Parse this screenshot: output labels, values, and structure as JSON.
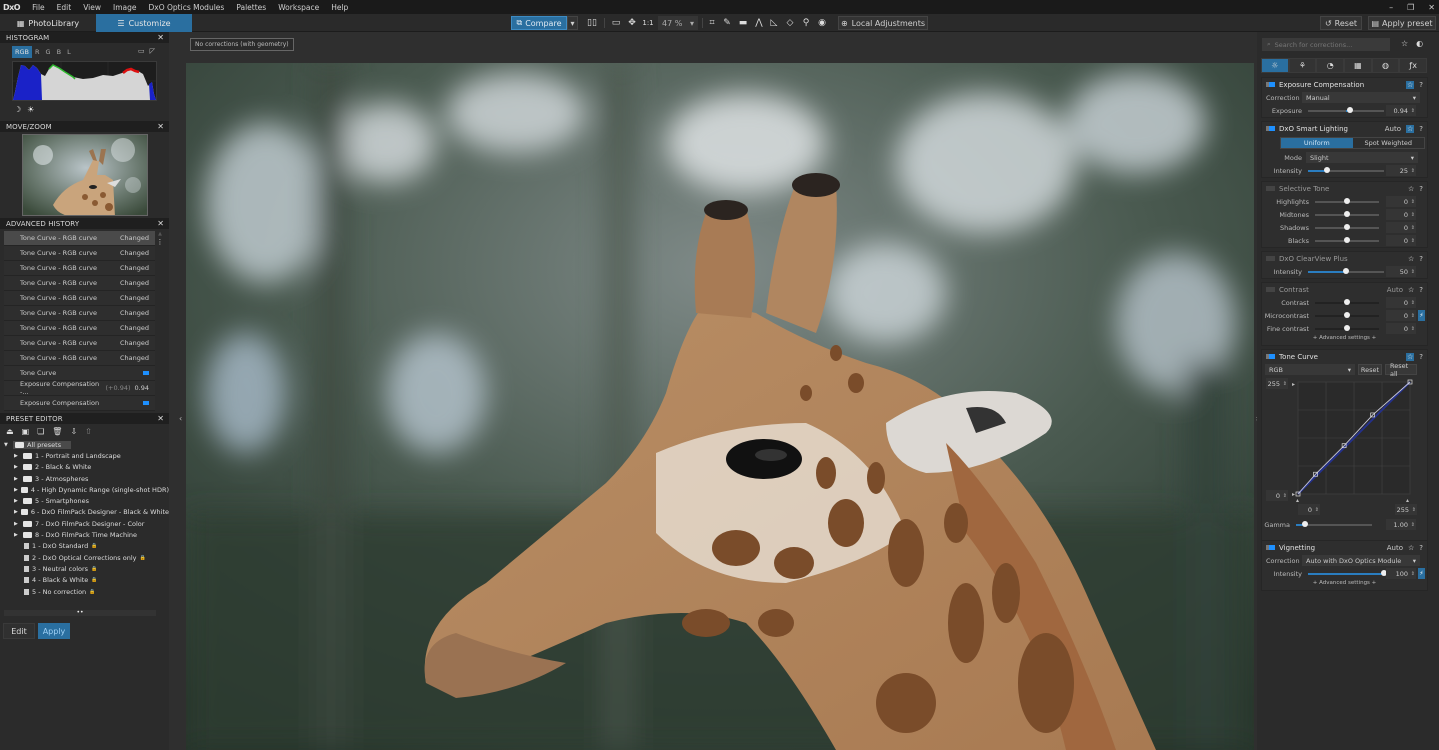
{
  "menubar": {
    "logo": "DxO",
    "items": [
      "File",
      "Edit",
      "View",
      "Image",
      "DxO Optics Modules",
      "Palettes",
      "Workspace",
      "Help"
    ],
    "window_controls": [
      "minimize",
      "restore",
      "close"
    ]
  },
  "toolbar": {
    "tabs": [
      {
        "label": "PhotoLibrary",
        "icon": "grid-icon"
      },
      {
        "label": "Customize",
        "icon": "sliders-icon",
        "active": true
      }
    ],
    "compare_label": "Compare",
    "zoom_one_to_one": "1:1",
    "zoom_level": "47 %",
    "local_adjustments_label": "Local Adjustments",
    "reset_label": "Reset",
    "apply_preset_label": "Apply preset",
    "tools": [
      "split-view-icon",
      "fit-icon",
      "move-icon",
      "crop-icon",
      "eyedropper-icon",
      "horizon-icon",
      "keystone-vertical-icon",
      "keystone-horizontal-icon",
      "keystone-8point-icon",
      "repair-icon",
      "red-eye-icon"
    ]
  },
  "histogram": {
    "title": "HISTOGRAM",
    "channels": [
      "RGB",
      "R",
      "G",
      "B",
      "L"
    ],
    "active_channel": "RGB"
  },
  "move_zoom": {
    "title": "MOVE/ZOOM"
  },
  "history": {
    "title": "ADVANCED HISTORY",
    "rows": [
      {
        "label": "Tone Curve - RGB curve",
        "value": "Changed",
        "selected": true
      },
      {
        "label": "Tone Curve - RGB curve",
        "value": "Changed"
      },
      {
        "label": "Tone Curve - RGB curve",
        "value": "Changed"
      },
      {
        "label": "Tone Curve - RGB curve",
        "value": "Changed"
      },
      {
        "label": "Tone Curve - RGB curve",
        "value": "Changed"
      },
      {
        "label": "Tone Curve - RGB curve",
        "value": "Changed"
      },
      {
        "label": "Tone Curve - RGB curve",
        "value": "Changed"
      },
      {
        "label": "Tone Curve - RGB curve",
        "value": "Changed"
      },
      {
        "label": "Tone Curve - RGB curve",
        "value": "Changed"
      },
      {
        "label": "Tone Curve",
        "value": "toggle-on"
      },
      {
        "label": "Exposure Compensation -...",
        "prev": "(+0.94)",
        "value": "0.94"
      },
      {
        "label": "Exposure Compensation",
        "value": "toggle-on"
      }
    ]
  },
  "preset_editor": {
    "title": "PRESET EDITOR",
    "root": "All presets",
    "folders": [
      "1 - Portrait and Landscape",
      "2 - Black & White",
      "3 - Atmospheres",
      "4 - High Dynamic Range (single-shot HDR)",
      "5 - Smartphones",
      "6 - DxO FilmPack Designer - Black & White",
      "7 - DxO FilmPack Designer - Color",
      "8 - DxO FilmPack Time Machine"
    ],
    "presets": [
      "1 - DxO Standard",
      "2 - DxO Optical Corrections only",
      "3 - Neutral colors",
      "4 - Black & White",
      "5 - No correction"
    ],
    "edit_label": "Edit",
    "apply_label": "Apply"
  },
  "viewer": {
    "correction_label": "No corrections (with geometry)"
  },
  "corrections": {
    "search_placeholder": "Search for corrections...",
    "category_tabs": [
      "light-icon",
      "color-icon",
      "detail-icon",
      "geometry-icon",
      "local-icon",
      "fx-icon"
    ],
    "exposure": {
      "title": "Exposure Compensation",
      "correction_label": "Correction",
      "correction_value": "Manual",
      "exposure_label": "Exposure",
      "exposure_value": "0.94",
      "exposure_fraction": 0.55
    },
    "smart_lighting": {
      "title": "DxO Smart Lighting",
      "auto": "Auto",
      "modes": [
        "Uniform",
        "Spot Weighted"
      ],
      "active_mode": "Uniform",
      "mode_label": "Mode",
      "mode_value": "Slight",
      "intensity_label": "Intensity",
      "intensity_value": "25",
      "intensity_fraction": 0.25
    },
    "selective_tone": {
      "title": "Selective Tone",
      "rows": [
        {
          "label": "Highlights",
          "value": "0"
        },
        {
          "label": "Midtones",
          "value": "0"
        },
        {
          "label": "Shadows",
          "value": "0"
        },
        {
          "label": "Blacks",
          "value": "0"
        }
      ]
    },
    "clearview": {
      "title": "DxO ClearView Plus",
      "intensity_label": "Intensity",
      "intensity_value": "50",
      "intensity_fraction": 0.5
    },
    "contrast": {
      "title": "Contrast",
      "auto": "Auto",
      "rows": [
        {
          "label": "Contrast",
          "value": "0"
        },
        {
          "label": "Microcontrast",
          "value": "0"
        },
        {
          "label": "Fine contrast",
          "value": "0"
        }
      ],
      "advanced": "+ Advanced settings +"
    },
    "tone_curve": {
      "title": "Tone Curve",
      "channel": "RGB",
      "reset_label": "Reset",
      "reset_all_label": "Reset all",
      "out_max": "255",
      "out_min": "0",
      "in_min": "0",
      "in_max": "255",
      "gamma_label": "Gamma",
      "gamma_value": "1.00",
      "points": [
        [
          0,
          0
        ],
        [
          40,
          45
        ],
        [
          105,
          110
        ],
        [
          170,
          180
        ],
        [
          255,
          255
        ]
      ]
    },
    "vignetting": {
      "title": "Vignetting",
      "auto": "Auto",
      "correction_label": "Correction",
      "correction_value": "Auto with DxO Optics Module",
      "intensity_label": "Intensity",
      "intensity_value": "100",
      "intensity_fraction": 1.0,
      "advanced": "+ Advanced settings +"
    }
  }
}
